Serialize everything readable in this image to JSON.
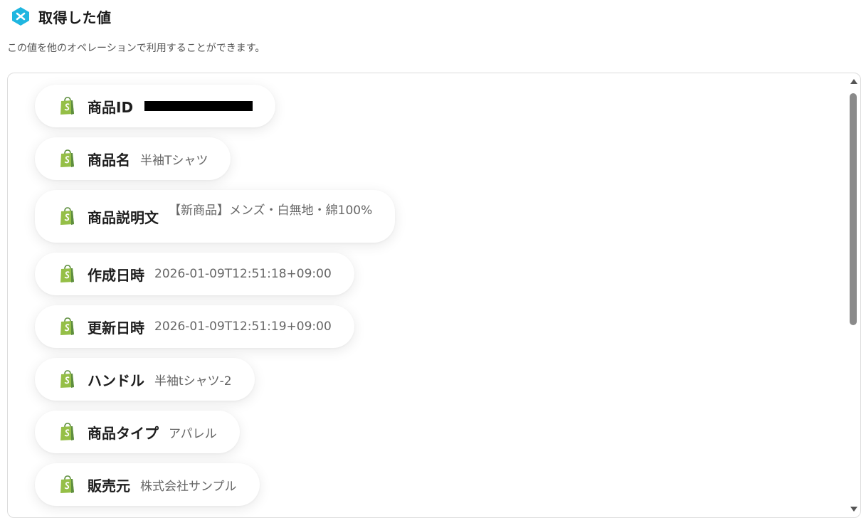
{
  "header": {
    "title": "取得した値",
    "subtitle": "この値を他のオペレーションで利用することができます。",
    "accent_color": "#1fb6e0"
  },
  "items": [
    {
      "label": "商品ID",
      "value": "",
      "redacted": true,
      "icon": "shopify-icon"
    },
    {
      "label": "商品名",
      "value": "半袖Tシャツ",
      "icon": "shopify-icon"
    },
    {
      "label": "商品説明文",
      "value": "【新商品】メンズ・白無地・綿100%",
      "icon": "shopify-icon"
    },
    {
      "label": "作成日時",
      "value": "2026-01-09T12:51:18+09:00",
      "icon": "shopify-icon"
    },
    {
      "label": "更新日時",
      "value": "2026-01-09T12:51:19+09:00",
      "icon": "shopify-icon"
    },
    {
      "label": "ハンドル",
      "value": "半袖tシャツ-2",
      "icon": "shopify-icon"
    },
    {
      "label": "商品タイプ",
      "value": "アパレル",
      "icon": "shopify-icon"
    },
    {
      "label": "販売元",
      "value": "株式会社サンプル",
      "icon": "shopify-icon"
    }
  ],
  "colors": {
    "shopify_green": "#95bf47",
    "shopify_dark": "#5e8e3e"
  }
}
